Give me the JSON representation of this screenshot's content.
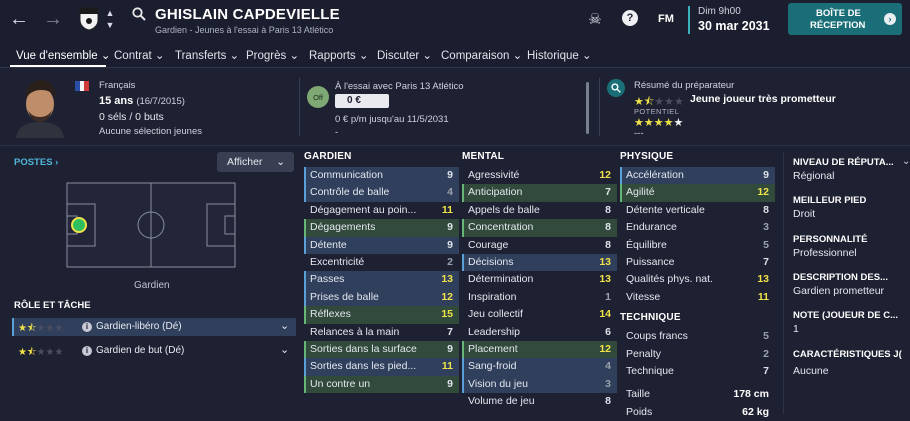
{
  "header": {
    "name": "GHISLAIN CAPDEVIELLE",
    "subtitle": "Gardien - Jeunes à l'essai à Paris 13 Atlético",
    "date_time": "Dim 9h00",
    "date": "30 mar 2031",
    "inbox_line1": "BOÎTE DE",
    "inbox_line2": "RÉCEPTION",
    "fm_label": "FM"
  },
  "nav": {
    "items": [
      "Vue d'ensemble",
      "Contrat",
      "Transferts",
      "Progrès",
      "Rapports",
      "Discuter",
      "Comparaison",
      "Historique"
    ]
  },
  "profile": {
    "nationality": "Français",
    "age": "15 ans",
    "dob": "(16/7/2015)",
    "caps": "0 séls / 0 buts",
    "youth": "Aucune sélection jeunes"
  },
  "contract": {
    "badge": "Off",
    "status": "À l'essai avec Paris 13 Atlético",
    "value": "0 €",
    "wage": "0 € p/m jusqu'au 11/5/2031",
    "dash": "-"
  },
  "scout": {
    "title": "Résumé du préparateur",
    "summary": "Jeune joueur très prometteur",
    "potential_label": "POTENTIEL",
    "dash": "---",
    "ability_stars": 1.5,
    "potential_stars": 4
  },
  "positions": {
    "title": "POSTES",
    "afficher": "Afficher",
    "caption": "Gardien"
  },
  "roles": {
    "title": "RÔLE ET TÂCHE",
    "items": [
      {
        "label": "Gardien-libéro (Dé)",
        "stars": 1.5
      },
      {
        "label": "Gardien de but (Dé)",
        "stars": 1.5
      }
    ]
  },
  "attributes": {
    "gardien": {
      "title": "GARDIEN",
      "rows": [
        {
          "name": "Communication",
          "value": "9",
          "style": "hl",
          "color": "w"
        },
        {
          "name": "Contrôle de balle",
          "value": "4",
          "style": "hl",
          "color": "d"
        },
        {
          "name": "Dégagement au poin...",
          "value": "11",
          "style": "",
          "color": "y"
        },
        {
          "name": "Dégagements",
          "value": "9",
          "style": "gr",
          "color": "w"
        },
        {
          "name": "Détente",
          "value": "9",
          "style": "hl",
          "color": "w"
        },
        {
          "name": "Excentricité",
          "value": "2",
          "style": "",
          "color": "d"
        },
        {
          "name": "Passes",
          "value": "13",
          "style": "hl",
          "color": "y"
        },
        {
          "name": "Prises de balle",
          "value": "12",
          "style": "hl",
          "color": "y"
        },
        {
          "name": "Réflexes",
          "value": "15",
          "style": "gr",
          "color": "y"
        },
        {
          "name": "Relances à la main",
          "value": "7",
          "style": "",
          "color": "w"
        },
        {
          "name": "Sorties dans la surface",
          "value": "9",
          "style": "gr",
          "color": "w"
        },
        {
          "name": "Sorties dans les pied...",
          "value": "11",
          "style": "hl",
          "color": "y"
        },
        {
          "name": "Un contre un",
          "value": "9",
          "style": "gr",
          "color": "w"
        }
      ]
    },
    "mental": {
      "title": "MENTAL",
      "rows": [
        {
          "name": "Agressivité",
          "value": "12",
          "style": "",
          "color": "y"
        },
        {
          "name": "Anticipation",
          "value": "7",
          "style": "gr",
          "color": "w"
        },
        {
          "name": "Appels de balle",
          "value": "8",
          "style": "",
          "color": "w"
        },
        {
          "name": "Concentration",
          "value": "8",
          "style": "gr",
          "color": "w"
        },
        {
          "name": "Courage",
          "value": "8",
          "style": "",
          "color": "w"
        },
        {
          "name": "Décisions",
          "value": "13",
          "style": "hl",
          "color": "y"
        },
        {
          "name": "Détermination",
          "value": "13",
          "style": "",
          "color": "y"
        },
        {
          "name": "Inspiration",
          "value": "1",
          "style": "",
          "color": "d"
        },
        {
          "name": "Jeu collectif",
          "value": "14",
          "style": "",
          "color": "y"
        },
        {
          "name": "Leadership",
          "value": "6",
          "style": "",
          "color": "w"
        },
        {
          "name": "Placement",
          "value": "12",
          "style": "gr",
          "color": "y"
        },
        {
          "name": "Sang-froid",
          "value": "4",
          "style": "hl",
          "color": "d"
        },
        {
          "name": "Vision du jeu",
          "value": "3",
          "style": "hl",
          "color": "d"
        },
        {
          "name": "Volume de jeu",
          "value": "8",
          "style": "",
          "color": "w"
        }
      ]
    },
    "physique": {
      "title": "PHYSIQUE",
      "rows": [
        {
          "name": "Accélération",
          "value": "9",
          "style": "hl",
          "color": "w"
        },
        {
          "name": "Agilité",
          "value": "12",
          "style": "gr",
          "color": "y"
        },
        {
          "name": "Détente verticale",
          "value": "8",
          "style": "",
          "color": "w"
        },
        {
          "name": "Endurance",
          "value": "3",
          "style": "",
          "color": "d"
        },
        {
          "name": "Équilibre",
          "value": "5",
          "style": "",
          "color": "d"
        },
        {
          "name": "Puissance",
          "value": "7",
          "style": "",
          "color": "w"
        },
        {
          "name": "Qualités phys. nat.",
          "value": "13",
          "style": "",
          "color": "y"
        },
        {
          "name": "Vitesse",
          "value": "11",
          "style": "",
          "color": "y"
        }
      ]
    },
    "technique": {
      "title": "TECHNIQUE",
      "rows": [
        {
          "name": "Coups francs",
          "value": "5",
          "style": "",
          "color": "d"
        },
        {
          "name": "Penalty",
          "value": "2",
          "style": "",
          "color": "d"
        },
        {
          "name": "Technique",
          "value": "7",
          "style": "",
          "color": "w"
        }
      ]
    },
    "size": {
      "height_label": "Taille",
      "height": "178 cm",
      "weight_label": "Poids",
      "weight": "62 kg"
    }
  },
  "side": [
    {
      "label": "NIVEAU DE RÉPUTA...",
      "value": "Régional"
    },
    {
      "label": "MEILLEUR PIED",
      "value": "Droit"
    },
    {
      "label": "PERSONNALITÉ",
      "value": "Professionnel"
    },
    {
      "label": "DESCRIPTION DES...",
      "value": "Gardien prometteur"
    },
    {
      "label": "NOTE (JOUEUR DE C...",
      "value": "1"
    },
    {
      "label": "CARACTÉRISTIQUES J(",
      "value": "Aucune"
    }
  ],
  "colors": {
    "accent": "#1a6e78",
    "yellow": "#f0e24a",
    "blue_row": "#2f3f5c",
    "green_row": "#314a3c"
  }
}
